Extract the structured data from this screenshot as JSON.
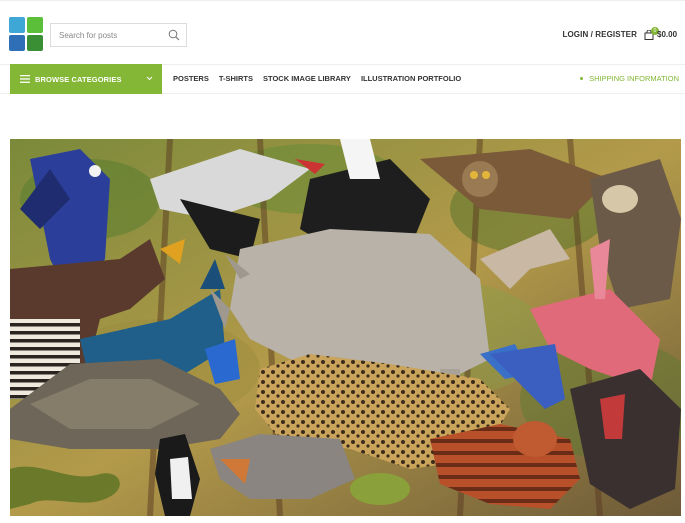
{
  "header": {
    "search_placeholder": "Search for posts",
    "login_label": "LOGIN / REGISTER",
    "cart_count": "0",
    "cart_total": "$0.00"
  },
  "nav": {
    "browse_label": "BROWSE CATEGORIES",
    "menu_items": [
      "POSTERS",
      "T-SHIRTS",
      "STOCK IMAGE LIBRARY",
      "ILLUSTRATION PORTFOLIO"
    ],
    "shipping_label": "SHIPPING INFORMATION"
  },
  "colors": {
    "accent": "#83b735",
    "text": "#333333"
  },
  "icons": {
    "search": "search-icon",
    "cart": "shopping-bag-icon",
    "menu": "hamburger-icon",
    "chevron": "chevron-down-icon"
  }
}
